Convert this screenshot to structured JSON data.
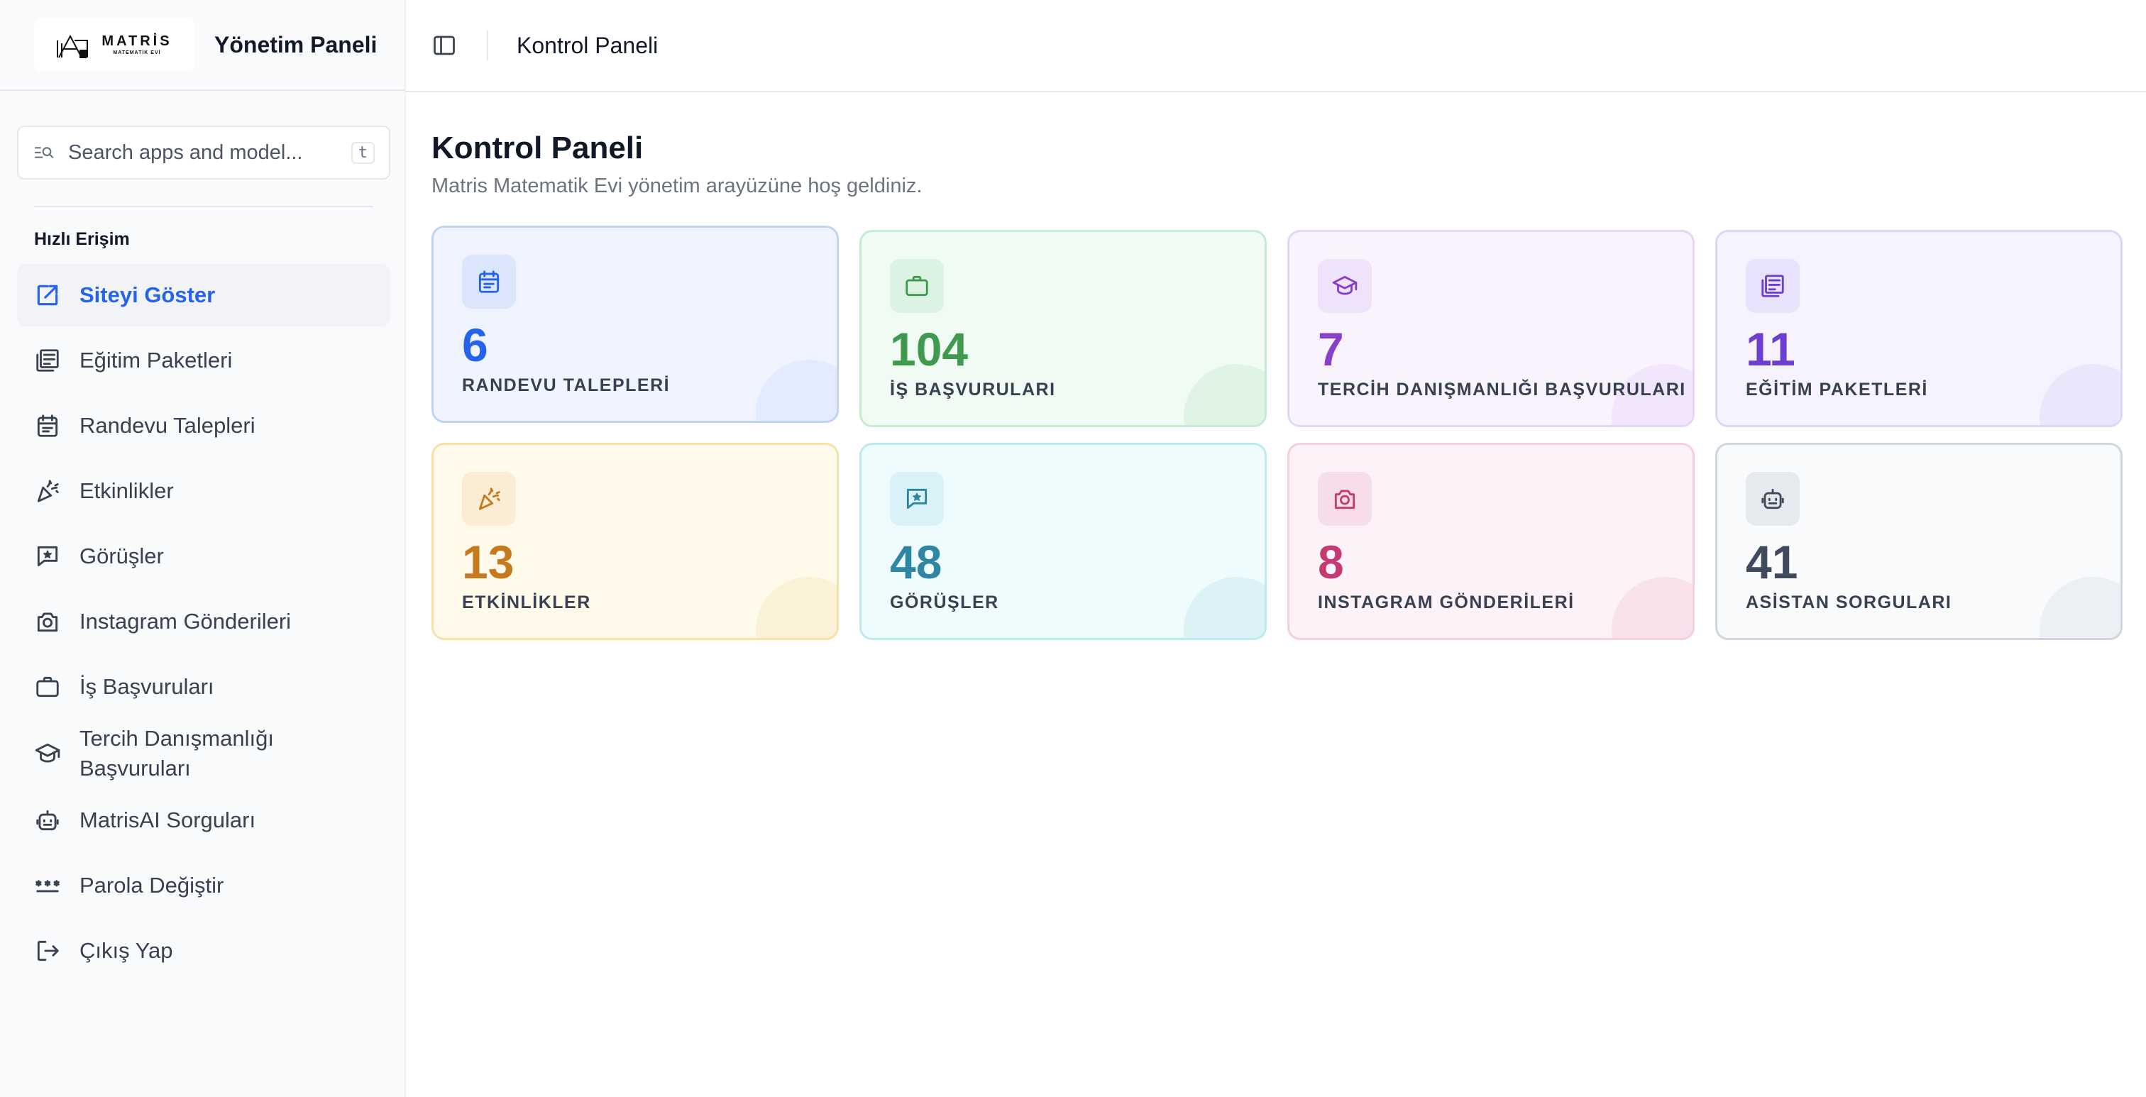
{
  "brand": {
    "logo_line1": "MATRİS",
    "logo_line2": "MATEMATİK EVİ",
    "title": "Yönetim Paneli"
  },
  "search": {
    "placeholder": "Search apps and model...",
    "shortcut": "t"
  },
  "sidebar": {
    "section_title": "Hızlı Erişim",
    "items": [
      {
        "label": "Siteyi Göster",
        "icon": "external-link-icon",
        "active": true
      },
      {
        "label": "Eğitim Paketleri",
        "icon": "newspaper-icon"
      },
      {
        "label": "Randevu Talepleri",
        "icon": "calendar-icon"
      },
      {
        "label": "Etkinlikler",
        "icon": "party-popper-icon"
      },
      {
        "label": "Görüşler",
        "icon": "message-star-icon"
      },
      {
        "label": "Instagram Gönderileri",
        "icon": "camera-icon"
      },
      {
        "label": "İş Başvuruları",
        "icon": "briefcase-icon"
      },
      {
        "label_line1": "Tercih Danışmanlığı",
        "label_line2": "Başvuruları",
        "icon": "graduation-cap-icon"
      },
      {
        "label": "MatrisAI Sorguları",
        "icon": "bot-icon"
      },
      {
        "label": "Parola Değiştir",
        "icon": "password-icon"
      },
      {
        "label": "Çıkış Yap",
        "icon": "logout-icon"
      }
    ]
  },
  "topbar": {
    "title": "Kontrol Paneli"
  },
  "main": {
    "title": "Kontrol Paneli",
    "subtitle": "Matris Matematik Evi yönetim arayüzüne hoş geldiniz."
  },
  "cards": [
    {
      "value": "6",
      "label": "RANDEVU TALEPLERİ",
      "icon": "calendar-icon",
      "accent": "#2563eb",
      "bg": "#eff4ff",
      "border": "#bfd4f3",
      "icon_bg": "#dbe6fd",
      "blob": "#e2ebff"
    },
    {
      "value": "104",
      "label": "İŞ BAŞVURULARI",
      "icon": "briefcase-icon",
      "accent": "#3f9a4e",
      "bg": "#f0fbf3",
      "border": "#c5ecd0",
      "icon_bg": "#dcf3e3",
      "blob": "#e0f4e6"
    },
    {
      "value": "7",
      "label": "TERCİH DANIŞMANLIĞI BAŞVURULARI",
      "icon": "graduation-cap-icon",
      "accent": "#8a3fc9",
      "bg": "#f8f3fd",
      "border": "#e6d5f4",
      "icon_bg": "#efe2fb",
      "blob": "#f1e6fb"
    },
    {
      "value": "11",
      "label": "EĞİTİM PAKETLERİ",
      "icon": "newspaper-icon",
      "accent": "#6d3fd0",
      "bg": "#f6f3fe",
      "border": "#ddd6f5",
      "icon_bg": "#e9e2fc",
      "blob": "#ece6fc"
    },
    {
      "value": "13",
      "label": "ETKİNLİKLER",
      "icon": "party-popper-icon",
      "accent": "#c57a1e",
      "bg": "#fffaea",
      "border": "#f7e2a6",
      "icon_bg": "#fbedd5",
      "blob": "#faf1d6"
    },
    {
      "value": "48",
      "label": "GÖRÜŞLER",
      "icon": "message-star-icon",
      "accent": "#2f86a3",
      "bg": "#effcfd",
      "border": "#bdeaf0",
      "icon_bg": "#d9f1f7",
      "blob": "#dcf2f6"
    },
    {
      "value": "8",
      "label": "INSTAGRAM GÖNDERİLERİ",
      "icon": "camera-icon",
      "accent": "#c43b73",
      "bg": "#fdf2f7",
      "border": "#f3cfe0",
      "icon_bg": "#f7dde9",
      "blob": "#f8e1eb"
    },
    {
      "value": "41",
      "label": "ASİSTAN SORGULARI",
      "icon": "bot-icon",
      "accent": "#3f4a5c",
      "bg": "#f8fafc",
      "border": "#d1d6de",
      "icon_bg": "#e6e9ee",
      "blob": "#eceff3"
    }
  ]
}
